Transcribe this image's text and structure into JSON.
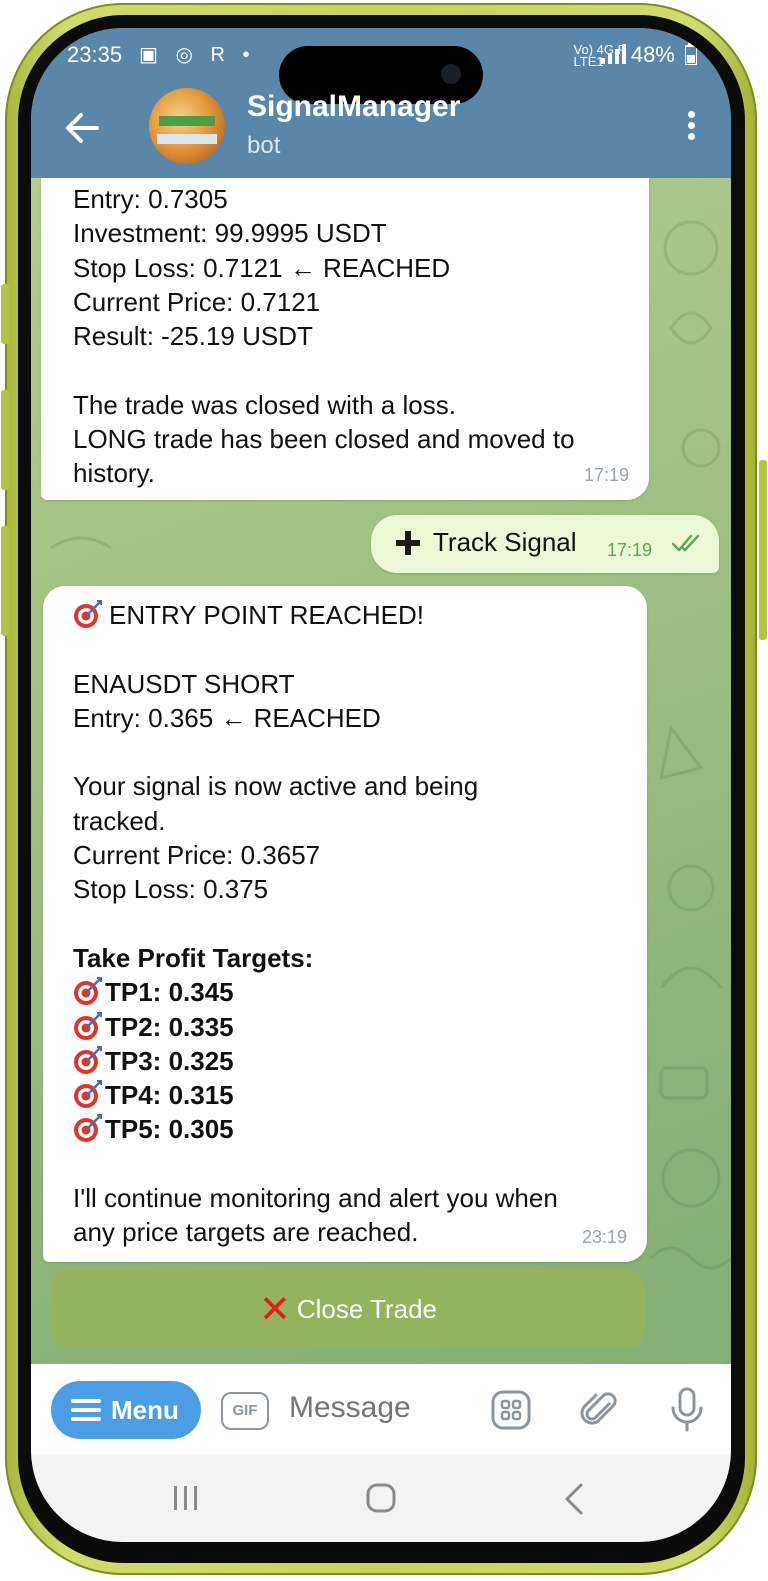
{
  "status_bar": {
    "time": "23:35",
    "left_icons": "▣ ◎ R •",
    "network_label": "Vo) 4G R\nLTE1",
    "battery": "48%"
  },
  "header": {
    "title": "SignalManager",
    "subtitle": "bot"
  },
  "messages": [
    {
      "lines": [
        "Entry: 0.7305",
        "Investment: 99.9995 USDT",
        "Stop Loss: 0.7121 ← REACHED",
        "Current Price: 0.7121",
        "Result: -25.19 USDT",
        "",
        "The trade was closed with a loss.",
        "LONG trade has been closed and moved to",
        "history."
      ],
      "time": "17:19"
    },
    {
      "text": "Track Signal",
      "time": "17:19"
    },
    {
      "heading": "ENTRY POINT REACHED!",
      "pair_line": "ENAUSDT SHORT",
      "entry_line": "Entry: 0.365 ← REACHED",
      "active_line_1": "Your signal is now active and being",
      "active_line_2": "tracked.",
      "current_price": "Current Price: 0.3657",
      "stop_loss": "Stop Loss: 0.375",
      "targets_heading": "Take Profit Targets:",
      "targets": [
        "TP1: 0.345",
        "TP2: 0.335",
        "TP3: 0.325",
        "TP4: 0.315",
        "TP5: 0.305"
      ],
      "footer_line_1": "I'll continue monitoring and alert you when",
      "footer_line_2": "any price targets are reached.",
      "time": "23:19"
    }
  ],
  "close_trade_label": "Close Trade",
  "input_bar": {
    "menu_label": "Menu",
    "gif_label": "GIF",
    "placeholder": "Message"
  },
  "colors": {
    "header_bg": "#5a87a9",
    "menu_button": "#4b9de4",
    "close_trade_button": "#93b35c",
    "outgoing_bubble": "#eaf8d6",
    "read_checks": "#5fa452"
  }
}
